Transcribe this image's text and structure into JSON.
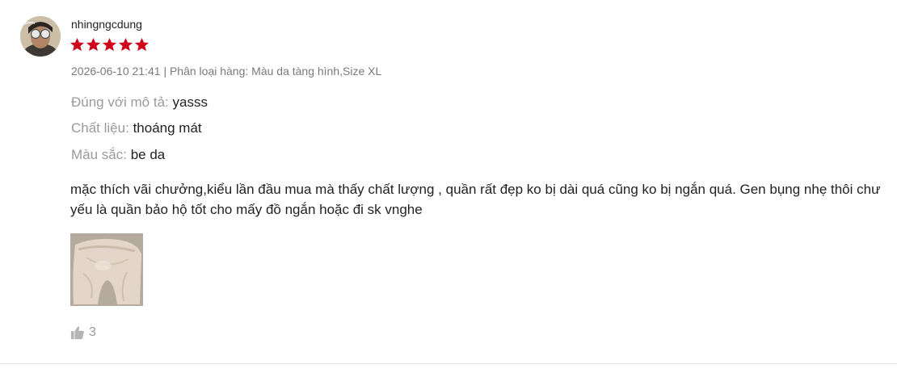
{
  "review": {
    "username": "nhingngcdung",
    "rating": 5,
    "rating_max": 5,
    "date": "2026-06-10 21:41",
    "separator": "|",
    "variation": "Phân loại hàng: Màu da tàng hình,Size XL",
    "attributes": [
      {
        "key": "Đúng với mô tả:",
        "value": "yasss"
      },
      {
        "key": "Chất liệu:",
        "value": "thoáng mát"
      },
      {
        "key": "Màu sắc:",
        "value": "be da"
      }
    ],
    "content_line1": "mặc thích vãi chưởng,kiểu lần đầu mua mà thấy chất lượng , quần rất đẹp ko bị dài quá cũng ko bị ngắn quá. Gen bụng nhẹ thôi chư",
    "content_line2": "yếu là quần bảo hộ tốt cho mấy đồ ngắn hoặc đi sk vnghe",
    "likes": "3"
  },
  "icons": {
    "star": "star-icon",
    "like": "thumbs-up-icon"
  },
  "colors": {
    "star": "#d0011b",
    "muted_text": "#9a9a9a",
    "body_text": "#222222",
    "meta_text": "#7a7a7a"
  }
}
